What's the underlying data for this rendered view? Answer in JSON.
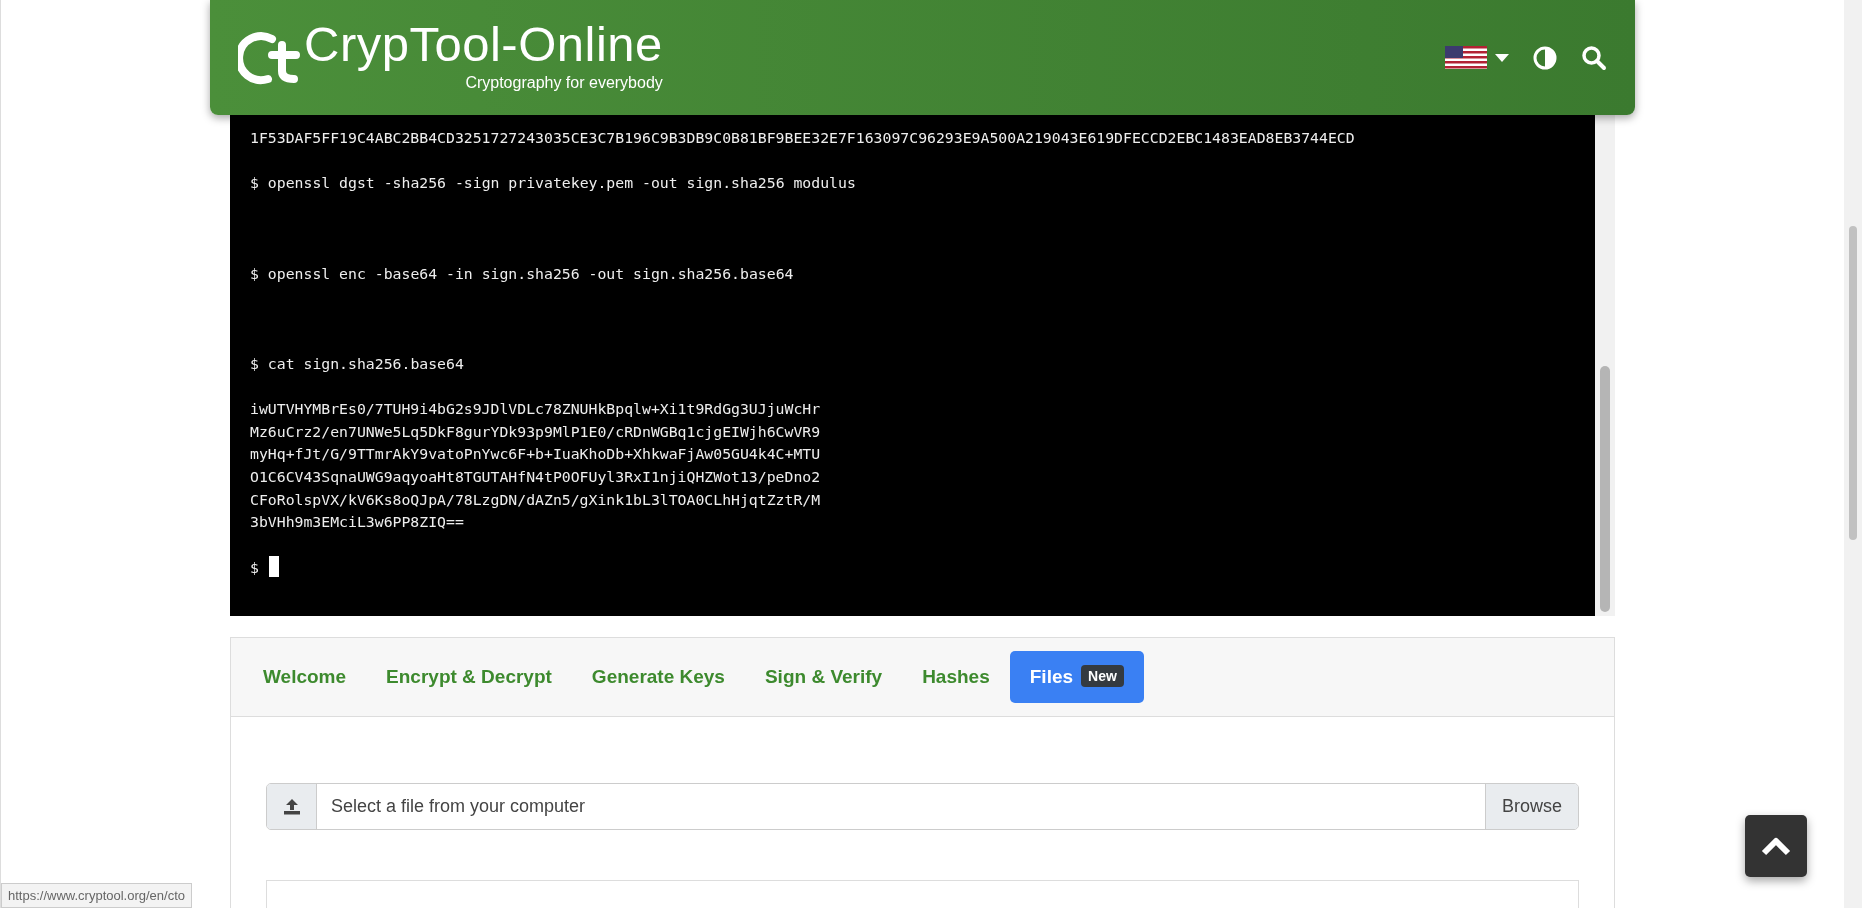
{
  "header": {
    "title": "CrypTool-Online",
    "subtitle": "Cryptography for everybody"
  },
  "terminal": {
    "entries": [
      {
        "kind": "output",
        "lines": [
          "1F53DAF5FF19C4ABC2BB4CD3251727243035CE3C7B196C9B3DB9C0B81BF9BEE32E7F163097C96293E9A500A219043E619DFECCD2EBC1483EAD8EB3744ECD"
        ]
      },
      {
        "kind": "command",
        "prompt": "$",
        "text": "openssl dgst -sha256 -sign privatekey.pem -out sign.sha256 modulus"
      },
      {
        "kind": "command",
        "prompt": "$",
        "text": "openssl enc -base64 -in sign.sha256 -out sign.sha256.base64"
      },
      {
        "kind": "command",
        "prompt": "$",
        "text": "cat sign.sha256.base64"
      },
      {
        "kind": "output",
        "lines": [
          "iwUTVHYMBrEs0/7TUH9i4bG2s9JDlVDLc78ZNUHkBpqlw+Xi1t9RdGg3UJjuWcHr",
          "Mz6uCrz2/en7UNWe5Lq5DkF8gurYDk93p9MlP1E0/cRDnWGBq1cjgEIWjh6CwVR9",
          "myHq+fJt/G/9TTmrAkY9vatoPnYwc6F+b+IuaKhoDb+XhkwaFjAw05GU4k4C+MTU",
          "O1C6CV43SqnaUWG9aqyoaHt8TGUTAHfN4tP0OFUyl3RxI1njiQHZWot13/peDno2",
          "CFoRolspVX/kV6Ks8oQJpA/78LzgDN/dAZn5/gXink1bL3lTOA0CLhHjqtZztR/M",
          "3bVHh9m3EMciL3w6PP8ZIQ=="
        ]
      },
      {
        "kind": "prompt",
        "prompt": "$",
        "cursor": true
      }
    ]
  },
  "tabs": [
    {
      "label": "Welcome",
      "selected": false
    },
    {
      "label": "Encrypt & Decrypt",
      "selected": false
    },
    {
      "label": "Generate Keys",
      "selected": false
    },
    {
      "label": "Sign & Verify",
      "selected": false
    },
    {
      "label": "Hashes",
      "selected": false
    },
    {
      "label": "Files",
      "selected": true,
      "badge": "New"
    }
  ],
  "file_input": {
    "placeholder": "Select a file from your computer",
    "button": "Browse"
  },
  "status_bar": {
    "url": "https://www.cryptool.org/en/cto"
  }
}
